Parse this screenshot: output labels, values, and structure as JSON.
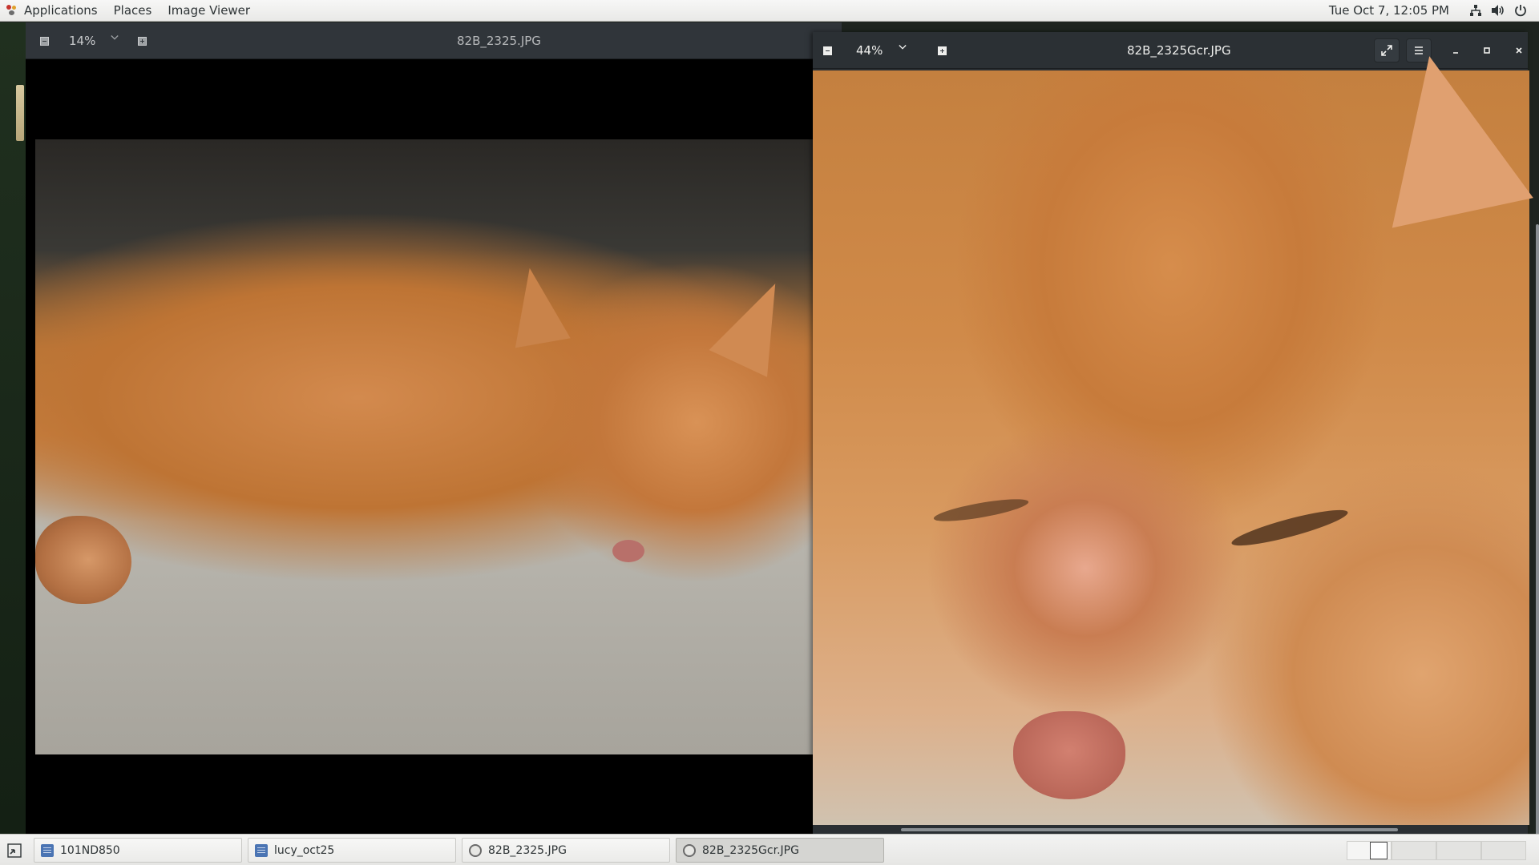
{
  "topbar": {
    "applications": "Applications",
    "places": "Places",
    "image_viewer": "Image Viewer",
    "clock": "Tue Oct  7, 12:05 PM",
    "tray_icons": [
      "network-icon",
      "volume-icon",
      "power-icon"
    ]
  },
  "window_left": {
    "zoom": "14%",
    "title": "82B_2325.JPG"
  },
  "window_right": {
    "zoom": "44%",
    "title": "82B_2325Gcr.JPG"
  },
  "taskbar": {
    "tasks": [
      {
        "label": "101ND850",
        "icon": "folder-icon"
      },
      {
        "label": "lucy_oct25",
        "icon": "folder-icon"
      },
      {
        "label": "82B_2325.JPG",
        "icon": "image-viewer-icon"
      },
      {
        "label": "82B_2325Gcr.JPG",
        "icon": "image-viewer-icon"
      }
    ]
  },
  "colors": {
    "header_dark": "#30353a",
    "topbar": "#efefed",
    "cat_orange": "#c98345"
  }
}
